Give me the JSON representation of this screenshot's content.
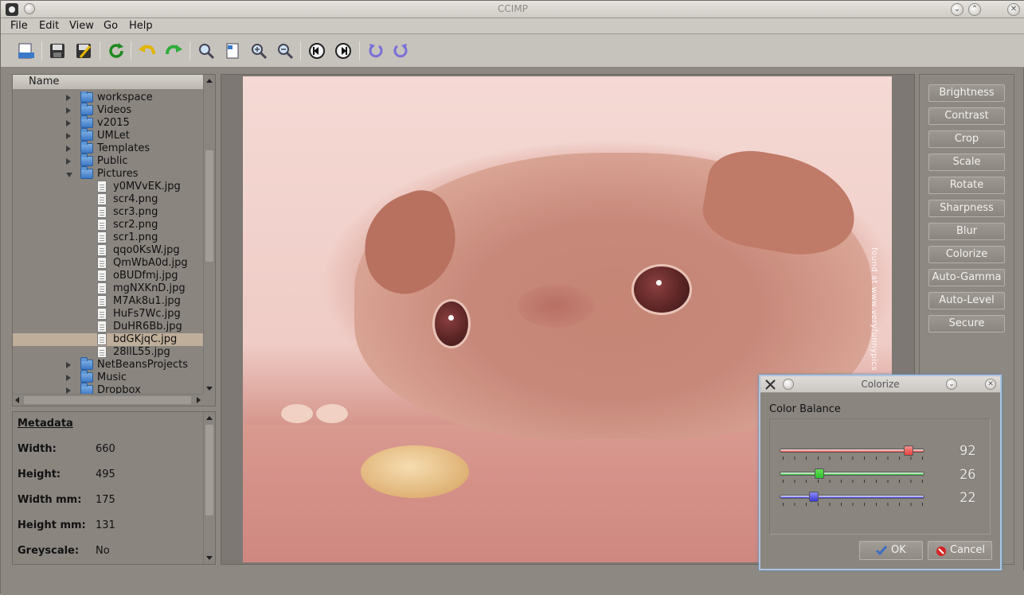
{
  "window": {
    "title": "CCIMP"
  },
  "menu": [
    "File",
    "Edit",
    "View",
    "Go",
    "Help"
  ],
  "toolbar": {
    "buttons": [
      "open-icon",
      "save-icon",
      "save-as-icon",
      "refresh-icon",
      "undo-icon",
      "redo-icon",
      "zoom-fit-icon",
      "page-icon",
      "zoom-in-icon",
      "zoom-out-icon",
      "previous-icon",
      "next-icon",
      "rotate-left-icon",
      "rotate-right-icon"
    ]
  },
  "tree": {
    "header": "Name",
    "rows": [
      {
        "label": "workspace",
        "type": "folder",
        "state": "closed",
        "level": 1
      },
      {
        "label": "Videos",
        "type": "folder",
        "state": "closed",
        "level": 1
      },
      {
        "label": "v2015",
        "type": "folder",
        "state": "closed",
        "level": 1
      },
      {
        "label": "UMLet",
        "type": "folder",
        "state": "closed",
        "level": 1
      },
      {
        "label": "Templates",
        "type": "folder",
        "state": "closed",
        "level": 1
      },
      {
        "label": "Public",
        "type": "folder",
        "state": "closed",
        "level": 1
      },
      {
        "label": "Pictures",
        "type": "folder",
        "state": "open",
        "level": 1
      },
      {
        "label": "y0MVvEK.jpg",
        "type": "file",
        "level": 2
      },
      {
        "label": "scr4.png",
        "type": "file",
        "level": 2
      },
      {
        "label": "scr3.png",
        "type": "file",
        "level": 2
      },
      {
        "label": "scr2.png",
        "type": "file",
        "level": 2
      },
      {
        "label": "scr1.png",
        "type": "file",
        "level": 2
      },
      {
        "label": "qqo0KsW.jpg",
        "type": "file",
        "level": 2
      },
      {
        "label": "QmWbA0d.jpg",
        "type": "file",
        "level": 2
      },
      {
        "label": "oBUDfmj.jpg",
        "type": "file",
        "level": 2
      },
      {
        "label": "mgNXKnD.jpg",
        "type": "file",
        "level": 2
      },
      {
        "label": "M7Ak8u1.jpg",
        "type": "file",
        "level": 2
      },
      {
        "label": "HuFs7Wc.jpg",
        "type": "file",
        "level": 2
      },
      {
        "label": "DuHR6Bb.jpg",
        "type": "file",
        "level": 2
      },
      {
        "label": "bdGKjqC.jpg",
        "type": "file",
        "level": 2,
        "selected": true
      },
      {
        "label": "28llL55.jpg",
        "type": "file",
        "level": 2
      },
      {
        "label": "NetBeansProjects",
        "type": "folder",
        "state": "closed",
        "level": 1
      },
      {
        "label": "Music",
        "type": "folder",
        "state": "closed",
        "level": 1
      },
      {
        "label": "Dropbox",
        "type": "folder",
        "state": "closed",
        "level": 1
      }
    ]
  },
  "metadata": {
    "title": "Metadata",
    "rows": [
      {
        "key": "Width:",
        "value": "660"
      },
      {
        "key": "Height:",
        "value": "495"
      },
      {
        "key": "Width mm:",
        "value": "175"
      },
      {
        "key": "Height mm:",
        "value": "131"
      },
      {
        "key": "Greyscale:",
        "value": "No"
      }
    ]
  },
  "image": {
    "watermark": "found at www.veryfunnypics"
  },
  "filters": [
    "Brightness",
    "Contrast",
    "Crop",
    "Scale",
    "Rotate",
    "Sharpness",
    "Blur",
    "Colorize",
    "Auto-Gamma",
    "Auto-Level",
    "Secure"
  ],
  "colorize_dialog": {
    "title": "Colorize",
    "group_label": "Color Balance",
    "sliders": [
      {
        "name": "red",
        "value": 92,
        "display": "92",
        "color": "#e8403c",
        "handle": "#ef8f8c"
      },
      {
        "name": "green",
        "value": 26,
        "display": "26",
        "color": "#2fbf2f",
        "handle": "#66dd55"
      },
      {
        "name": "blue",
        "value": 22,
        "display": "22",
        "color": "#3a3ad4",
        "handle": "#8a8cf5"
      }
    ],
    "ok_label": "OK",
    "cancel_label": "Cancel"
  }
}
